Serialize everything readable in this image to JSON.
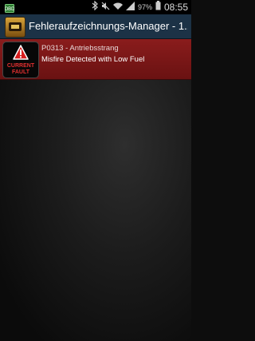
{
  "status_bar": {
    "battery_percent": "97%",
    "time": "08:55",
    "icons": [
      "signal-indicator-icon",
      "bluetooth-icon",
      "mute-icon",
      "wifi-icon",
      "cell-signal-icon",
      "battery-icon"
    ]
  },
  "action_bar": {
    "title": "Fehleraufzeichnungs-Manager - 1..",
    "icon": "car-icon"
  },
  "faults": [
    {
      "icon": "warning-triangle-icon",
      "badge_line1": "CURRENT",
      "badge_line2": "FAULT",
      "code": "P0313 - Antriebsstrang",
      "description": "Misfire Detected with Low Fuel"
    }
  ],
  "colors": {
    "action_bar": "#1c3246",
    "fault_row": "#7a1818",
    "badge_text": "#e23030"
  }
}
